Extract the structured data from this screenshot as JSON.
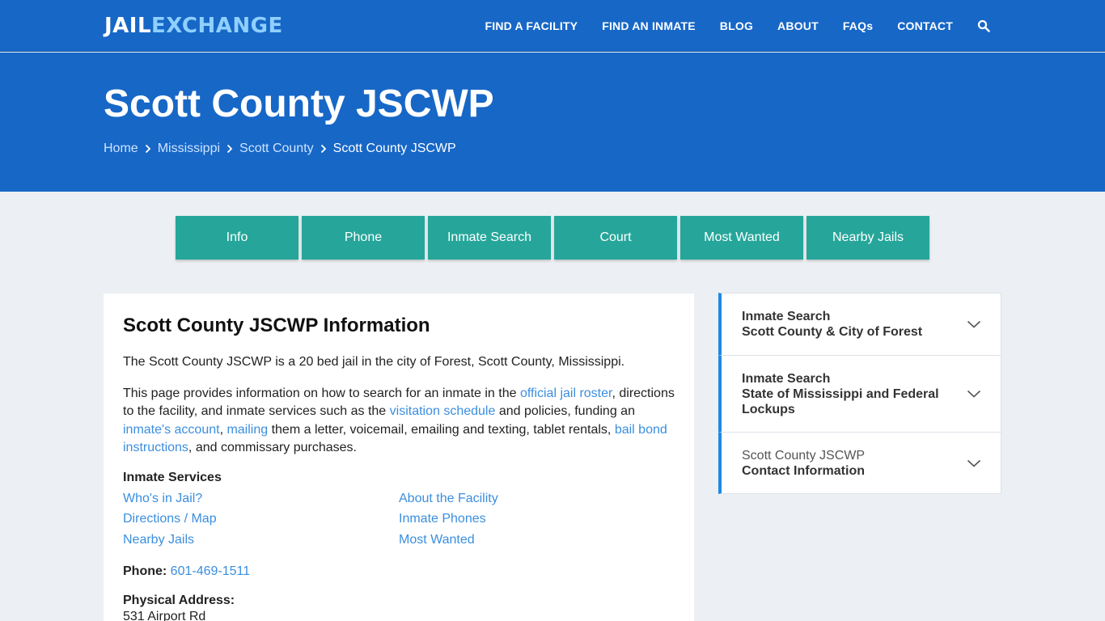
{
  "header": {
    "logo_part1": "JAIL",
    "logo_part2": "EXCHANGE",
    "nav": [
      "FIND A FACILITY",
      "FIND AN INMATE",
      "BLOG",
      "ABOUT",
      "FAQs",
      "CONTACT"
    ],
    "search_icon": "search-icon"
  },
  "hero": {
    "title": "Scott County JSCWP",
    "breadcrumb": [
      "Home",
      "Mississippi",
      "Scott County",
      "Scott County JSCWP"
    ]
  },
  "tabs": [
    "Info",
    "Phone",
    "Inmate Search",
    "Court",
    "Most Wanted",
    "Nearby Jails"
  ],
  "main": {
    "heading": "Scott County JSCWP Information",
    "intro": "The Scott County JSCWP is a 20 bed jail in the city of Forest, Scott County, Mississippi.",
    "para": {
      "t1": "This page provides information on how to search for an inmate in the ",
      "l1": "official jail roster",
      "t2": ", directions to the facility, and inmate services such as the ",
      "l2": "visitation schedule",
      "t3": " and policies, funding an ",
      "l3": "inmate's account",
      "t4": ", ",
      "l4": "mailing",
      "t5": " them a letter, voicemail, emailing and texting, tablet rentals, ",
      "l5": "bail bond instructions",
      "t6": ", and commissary purchases."
    },
    "services_title": "Inmate Services",
    "services": [
      "Who's in Jail?",
      "About the Facility",
      "Directions / Map",
      "Inmate Phones",
      "Nearby Jails",
      "Most Wanted"
    ],
    "phone_label": "Phone:",
    "phone": "601-469-1511",
    "address_label": "Physical Address:",
    "address_line1": "531 Airport Rd"
  },
  "sidebar": [
    {
      "line1": "Inmate Search",
      "line2": "Scott County & City of Forest"
    },
    {
      "line1": "Inmate Search",
      "line2": "State of Mississippi and Federal Lockups"
    },
    {
      "line1": "Scott County JSCWP",
      "line2": "Contact Information"
    }
  ],
  "colors": {
    "header_blue": "#1767c7",
    "tab_teal": "#26a69a",
    "link_blue": "#3b8ede",
    "accent_border": "#1e88e5"
  }
}
